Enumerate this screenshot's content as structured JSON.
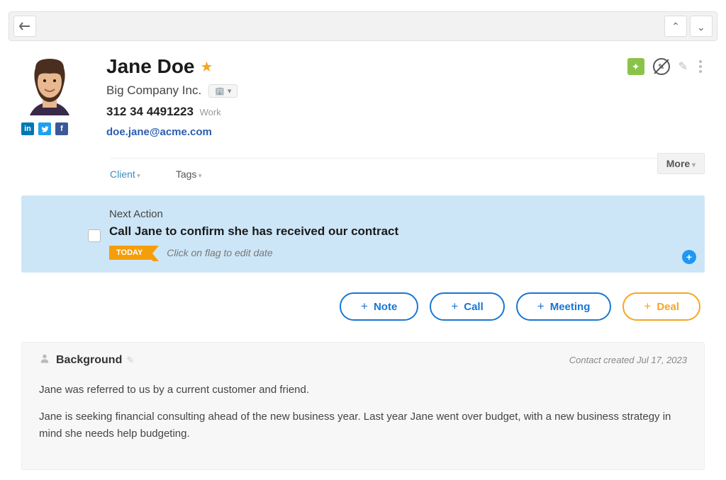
{
  "contact": {
    "name": "Jane Doe",
    "company": "Big Company Inc.",
    "phone": "312 34 4491223",
    "phone_type": "Work",
    "email": "doe.jane@acme.com"
  },
  "tags": {
    "client": "Client",
    "tags": "Tags"
  },
  "more": {
    "label": "More"
  },
  "next_action": {
    "label": "Next Action",
    "text": "Call Jane to confirm she has received our contract",
    "flag": "TODAY",
    "hint": "Click on flag to edit date"
  },
  "buttons": {
    "note": "Note",
    "call": "Call",
    "meeting": "Meeting",
    "deal": "Deal"
  },
  "background": {
    "title": "Background",
    "created": "Contact created Jul 17, 2023",
    "p1": "Jane was referred to us by a current customer and friend.",
    "p2": "Jane is seeking financial consulting ahead of the new business year. Last year Jane went over budget, with a new business strategy in mind she needs help budgeting."
  }
}
